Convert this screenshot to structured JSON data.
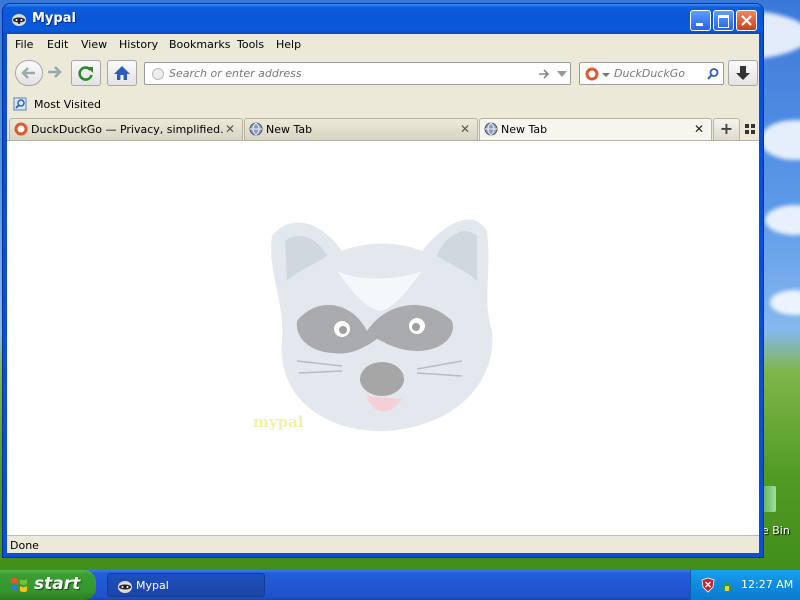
{
  "window": {
    "title": "Mypal"
  },
  "menu": {
    "items": [
      "File",
      "Edit",
      "View",
      "History",
      "Bookmarks",
      "Tools",
      "Help"
    ]
  },
  "navbar": {
    "url_placeholder": "Search or enter address",
    "search_engine": "DuckDuckGo",
    "search_placeholder": "DuckDuckGo"
  },
  "bookmarks": {
    "items": [
      "Most Visited"
    ]
  },
  "tabs": [
    {
      "label": "DuckDuckGo — Privacy, simplified.",
      "icon": "duckduckgo-icon",
      "active": false
    },
    {
      "label": "New Tab",
      "icon": "globe-icon",
      "active": false
    },
    {
      "label": "New Tab",
      "icon": "globe-icon",
      "active": true
    }
  ],
  "content": {
    "watermark_text": "mypal"
  },
  "status": {
    "text": "Done"
  },
  "desktop": {
    "recycle_bin_label": "e Bin"
  },
  "taskbar": {
    "start_label": "start",
    "tasks": [
      "Mypal"
    ],
    "clock": "12:27 AM"
  },
  "colors": {
    "titlebar": "#0a55d8",
    "taskbar": "#245edb",
    "start": "#3a9d32",
    "tray": "#0f8be0",
    "chrome": "#ece9d8"
  }
}
